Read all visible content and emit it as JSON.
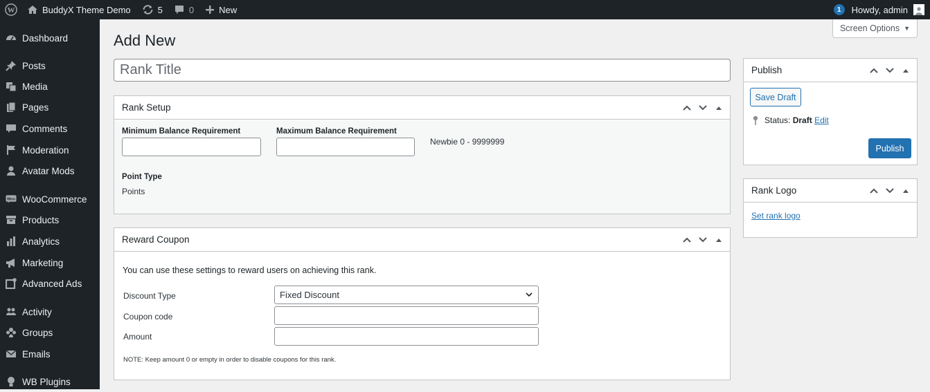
{
  "adminbar": {
    "site_name": "BuddyX Theme Demo",
    "updates_count": "5",
    "comments_count": "0",
    "new_label": "New",
    "notification_count": "1",
    "howdy": "Howdy, admin"
  },
  "sidebar": {
    "items": [
      {
        "label": "Dashboard",
        "icon": "dashboard-icon"
      },
      {
        "label": "Posts",
        "icon": "pin-icon"
      },
      {
        "label": "Media",
        "icon": "media-icon"
      },
      {
        "label": "Pages",
        "icon": "pages-icon"
      },
      {
        "label": "Comments",
        "icon": "comment-icon"
      },
      {
        "label": "Moderation",
        "icon": "flag-icon"
      },
      {
        "label": "Avatar Mods",
        "icon": "user-icon"
      },
      {
        "label": "WooCommerce",
        "icon": "woo-icon"
      },
      {
        "label": "Products",
        "icon": "archive-icon"
      },
      {
        "label": "Analytics",
        "icon": "bar-chart-icon"
      },
      {
        "label": "Marketing",
        "icon": "megaphone-icon"
      },
      {
        "label": "Advanced Ads",
        "icon": "ads-icon"
      },
      {
        "label": "Activity",
        "icon": "activity-icon"
      },
      {
        "label": "Groups",
        "icon": "groups-icon"
      },
      {
        "label": "Emails",
        "icon": "email-icon"
      },
      {
        "label": "WB Plugins",
        "icon": "lightbulb-icon"
      }
    ]
  },
  "screen_options": "Screen Options",
  "page_title": "Add New",
  "title_input": {
    "placeholder": "Rank Title",
    "value": ""
  },
  "rank_setup": {
    "title": "Rank Setup",
    "min_label": "Minimum Balance Requirement",
    "min_value": "",
    "max_label": "Maximum Balance Requirement",
    "max_value": "",
    "range_preview": "Newbie 0 - 9999999",
    "point_type_label": "Point Type",
    "point_type_value": "Points"
  },
  "reward_coupon": {
    "title": "Reward Coupon",
    "intro": "You can use these settings to reward users on achieving this rank.",
    "discount_type_label": "Discount Type",
    "discount_type_value": "Fixed Discount",
    "coupon_code_label": "Coupon code",
    "coupon_code_value": "",
    "amount_label": "Amount",
    "amount_value": "",
    "note": "NOTE: Keep amount 0 or empty in order to disable coupons for this rank."
  },
  "publish_box": {
    "title": "Publish",
    "save_draft": "Save Draft",
    "status_label": "Status:",
    "status_value": "Draft",
    "edit_link": "Edit",
    "publish_button": "Publish"
  },
  "rank_logo_box": {
    "title": "Rank Logo",
    "set_link": "Set rank logo"
  },
  "colors": {
    "accent": "#2271b1",
    "adminbar": "#1d2327",
    "background": "#f0f0f1"
  }
}
